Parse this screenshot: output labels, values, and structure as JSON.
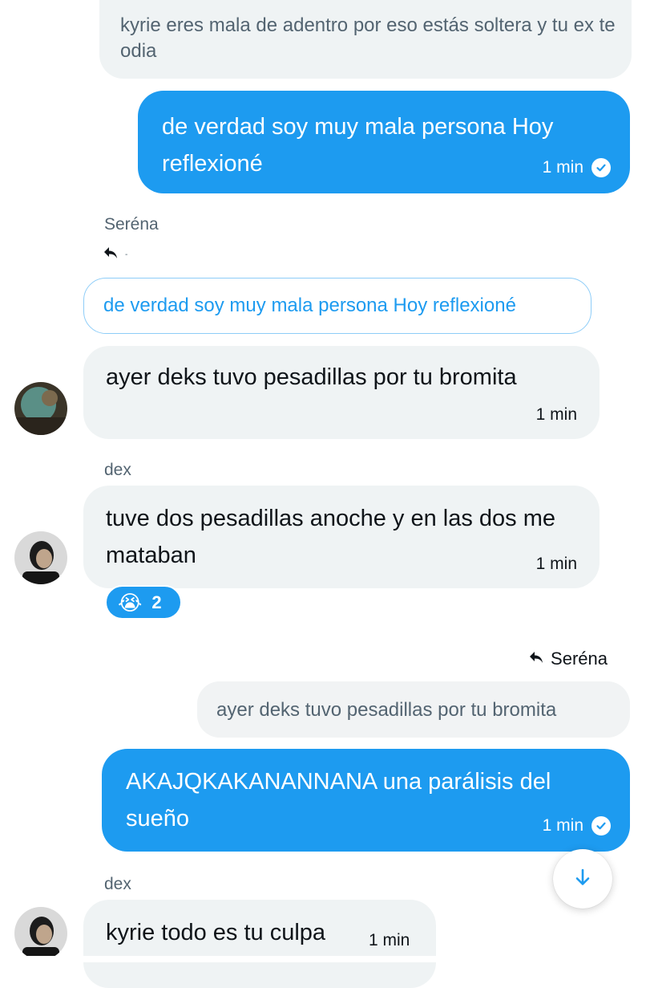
{
  "messages": {
    "m1": {
      "text": "kyrie eres mala de adentro por eso estás soltera y tu ex te odia"
    },
    "m2": {
      "text": "de verdad soy muy mala persona Hoy reflexioné",
      "time": "1 min"
    },
    "m3": {
      "reply_to_name": "Seréna",
      "reply_marker": "-",
      "quote": "de verdad soy muy mala persona Hoy reflexioné",
      "text": "ayer deks tuvo pesadillas por tu bromita",
      "time": "1 min"
    },
    "m4": {
      "sender": "dex",
      "text": "tuve dos pesadillas anoche y en las dos me mataban",
      "time": "1 min",
      "reaction": {
        "emoji": "😭",
        "count": "2"
      }
    },
    "m5": {
      "reply_to_name": "Seréna",
      "quote": "ayer deks tuvo pesadillas por tu bromita",
      "text": "AKAJQKAKANANNANA una parálisis del sueño",
      "time": "1 min"
    },
    "m6": {
      "sender": "dex",
      "text": "kyrie todo es tu culpa",
      "time": "1 min"
    }
  },
  "colors": {
    "accent": "#1d9bf0",
    "bubble_gray": "#eff3f4",
    "text_secondary": "#536471"
  },
  "icons": {
    "sent": "check-circle-icon",
    "reply": "reply-arrow-icon",
    "scroll": "arrow-down-icon"
  }
}
